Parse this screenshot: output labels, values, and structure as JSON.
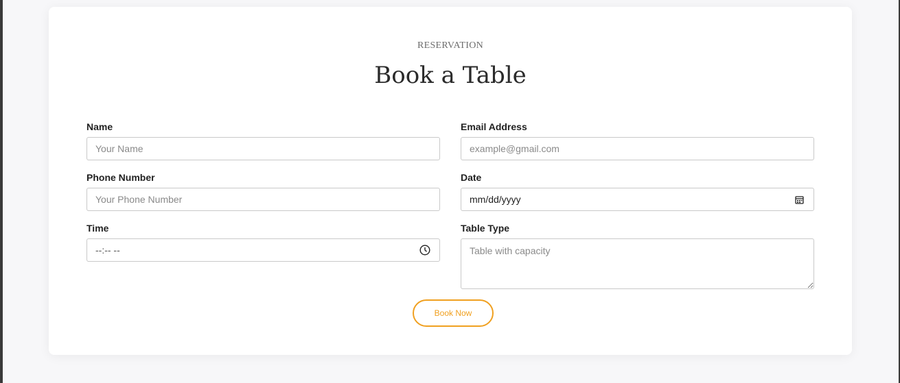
{
  "reservation": {
    "eyebrow": "RESERVATION",
    "title": "Book a Table"
  },
  "form": {
    "name": {
      "label": "Name",
      "placeholder": "Your Name"
    },
    "email": {
      "label": "Email Address",
      "placeholder": "example@gmail.com"
    },
    "phone": {
      "label": "Phone Number",
      "placeholder": "Your Phone Number"
    },
    "date": {
      "label": "Date",
      "value": "mm/dd/yyyy",
      "icon": "calendar-icon"
    },
    "time": {
      "label": "Time",
      "value": "--:-- --",
      "icon": "clock-icon"
    },
    "table_type": {
      "label": "Table Type",
      "placeholder": "Table with capacity"
    },
    "submit_label": "Book Now"
  },
  "colors": {
    "accent": "#f0a020",
    "background": "#f7f7f9",
    "card": "#ffffff",
    "border": "#c9c9c9"
  }
}
